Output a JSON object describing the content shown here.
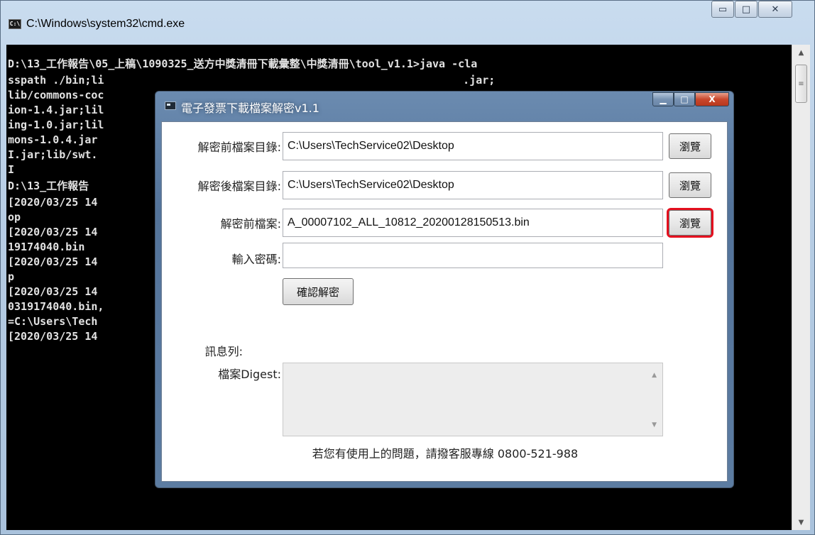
{
  "cmd": {
    "title": "C:\\Windows\\system32\\cmd.exe",
    "icon": "cmd-console-icon",
    "caption": {
      "minimize": "▭",
      "maximize": "□",
      "close": "✕"
    },
    "lines": [
      "D:\\13_工作報告\\05_上稿\\1090325_送方中獎清冊下載彙整\\中獎清冊\\tool_v1.1>java -cla",
      "sspath ./bin;li                                                        .jar;",
      "lib/commons-coc                                                        gurat",
      "ion-1.4.jar;lil                                                        -logg",
      "ing-1.0.jar;lil                                                        v-com",
      "mons-1.0.4.jar                                                         ientU",
      "I.jar;lib/swt.                                                         ryptU",
      "I",
      "D:\\13_工作報告",
      "[2020/03/25 14                                                         Deskt",
      "op",
      "[2020/03/25 14                                                         02003",
      "19174040.bin",
      "[2020/03/25 14                                                         eskto",
      "p",
      "[2020/03/25 14                                                         _2020",
      "0319174040.bin,                                                        ptDir",
      "=C:\\Users\\Tech",
      "[2020/03/25 14"
    ],
    "scrollbar": {
      "up": "▲",
      "down": "▼",
      "thumb": "≡"
    }
  },
  "dialog": {
    "title": "電子發票下載檔案解密v1.1",
    "caption": {
      "minimize": "▁",
      "maximize": "□",
      "close": "X"
    },
    "fields": {
      "src_dir": {
        "label": "解密前檔案目錄:",
        "value": "C:\\Users\\TechService02\\Desktop",
        "button": "瀏覽"
      },
      "dst_dir": {
        "label": "解密後檔案目錄:",
        "value": "C:\\Users\\TechService02\\Desktop",
        "button": "瀏覽"
      },
      "src_file": {
        "label": "解密前檔案:",
        "value": "A_00007102_ALL_10812_20200128150513.bin",
        "button": "瀏覽"
      },
      "password": {
        "label": "輸入密碼:",
        "value": ""
      }
    },
    "confirm_button": "確認解密",
    "message_label": "訊息列:",
    "digest_label": "檔案Digest:",
    "digest_value": "",
    "digest_scroll": {
      "up": "▲",
      "down": "▼"
    },
    "footer": "若您有使用上的問題，請撥客服專線  0800-521-988"
  },
  "colors": {
    "highlight": "#e5101f",
    "console_bg": "#000000",
    "console_text": "#e2e2e2"
  }
}
